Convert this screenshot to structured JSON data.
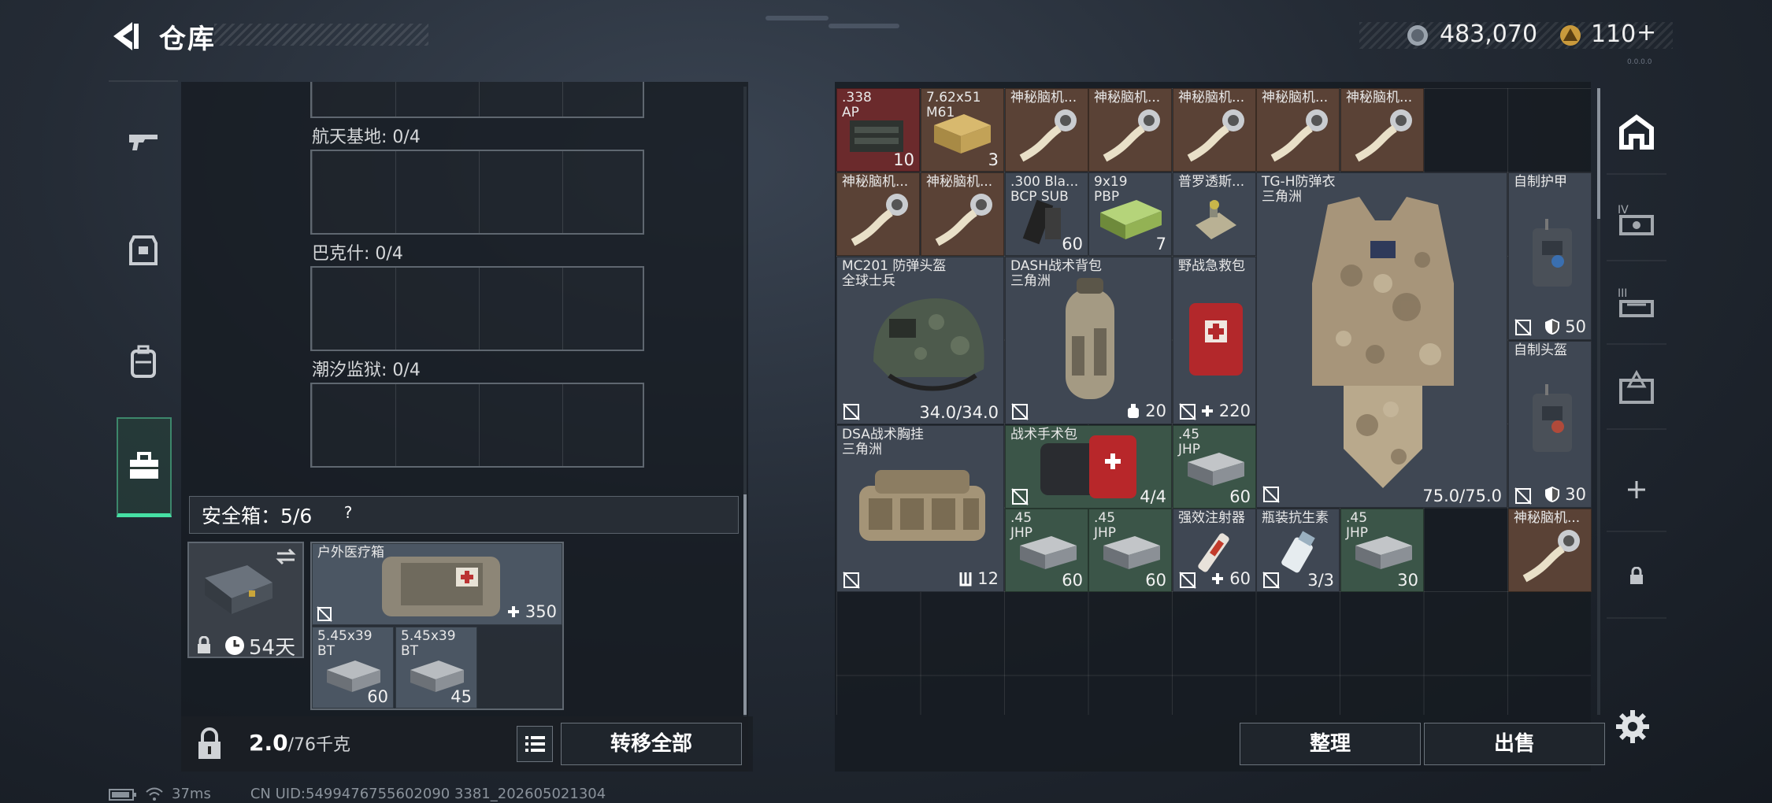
{
  "header": {
    "title": "仓库",
    "coins": "483,070",
    "bonds": "110",
    "bonds_plus": "+",
    "version": "0.0.0.0"
  },
  "nav": {
    "items": [
      "weapon-icon",
      "armor-icon",
      "backpack-icon",
      "toolbox-icon"
    ],
    "active": 3
  },
  "left_panel": {
    "maps": [
      {
        "label": "航天基地: 0/4"
      },
      {
        "label": "巴克什: 0/4"
      },
      {
        "label": "潮汐监狱: 0/4"
      }
    ],
    "safe_box": {
      "title": "安全箱：5/6",
      "help": "?",
      "case_days": "54天"
    },
    "safe_items": [
      {
        "name": "户外医疗箱",
        "count": "350"
      },
      {
        "name": "5.45x39\nBT",
        "count": "60"
      },
      {
        "name": "5.45x39\nBT",
        "count": "45"
      }
    ],
    "weight": "2.0",
    "weight_max": "/76千克",
    "transfer_label": "转移全部"
  },
  "stash": {
    "items": [
      {
        "name": ".338\nAP",
        "count": "10"
      },
      {
        "name": "7.62x51\nM61",
        "count": "3"
      },
      {
        "name": "神秘脑机...",
        "count": ""
      },
      {
        "name": "神秘脑机...",
        "count": ""
      },
      {
        "name": "神秘脑机...",
        "count": ""
      },
      {
        "name": "神秘脑机...",
        "count": ""
      },
      {
        "name": "神秘脑机...",
        "count": ""
      },
      {
        "name": "神秘脑机...",
        "count": ""
      },
      {
        "name": "神秘脑机...",
        "count": ""
      },
      {
        "name": ".300 Bla...\nBCP SUB",
        "count": "60"
      },
      {
        "name": "9x19\nPBP",
        "count": "7"
      },
      {
        "name": "普罗透斯...",
        "count": ""
      },
      {
        "name": "TG-H防弹衣\n三角洲",
        "count": "75.0/75.0"
      },
      {
        "name": "自制护甲",
        "count": "50"
      },
      {
        "name": "MC201 防弹头盔\n全球士兵",
        "count": "34.0/34.0"
      },
      {
        "name": "DASH战术背包\n三角洲",
        "count": "20"
      },
      {
        "name": "野战急救包",
        "count": "220"
      },
      {
        "name": "自制头盔",
        "count": "30"
      },
      {
        "name": "DSA战术胸挂\n三角洲",
        "count": "12"
      },
      {
        "name": "战术手术包",
        "count": "4/4"
      },
      {
        "name": ".45\nJHP",
        "count": "60"
      },
      {
        "name": ".45\nJHP",
        "count": "60"
      },
      {
        "name": ".45\nJHP",
        "count": "60"
      },
      {
        "name": "强效注射器",
        "count": "60"
      },
      {
        "name": "瓶装抗生素",
        "count": "3/3"
      },
      {
        "name": ".45\nJHP",
        "count": "30"
      },
      {
        "name": "神秘脑机...",
        "count": ""
      }
    ],
    "arrange_label": "整理",
    "sell_label": "出售"
  },
  "right_tabs": [
    "vault-icon",
    "rank-iv-icon",
    "rank-iii-icon",
    "rank-triangle-icon",
    "add-icon",
    "lock-icon"
  ],
  "status_bar": {
    "ping": "37ms",
    "uid": "CN UID:5499476755602090 3381_202605021304"
  },
  "colors": {
    "accent": "#46e0a4",
    "brown_cell": "#5a4236",
    "red_cell": "#6b2a2c",
    "green_cell": "#3b5548",
    "gray_cell": "#4b5663"
  }
}
